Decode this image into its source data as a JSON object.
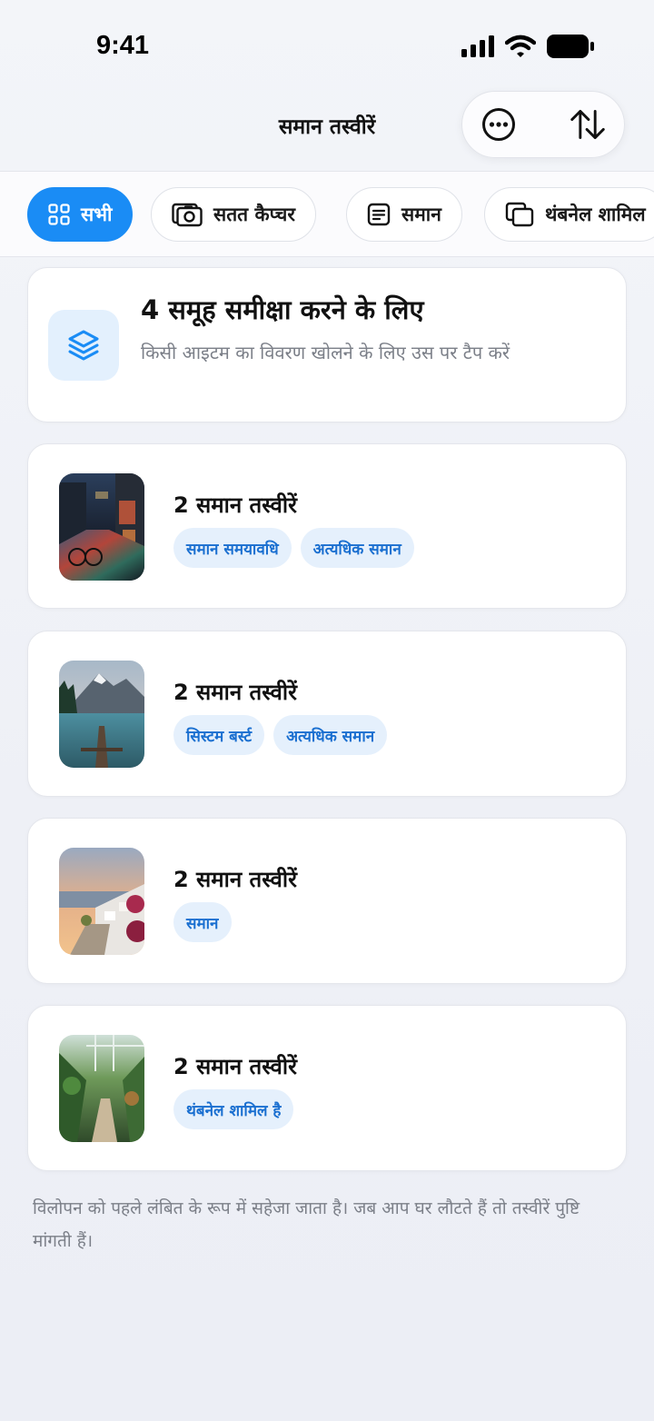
{
  "status_bar": {
    "time": "9:41"
  },
  "header": {
    "title": "समान तस्वीरें",
    "more_icon": "ellipsis-circle-icon",
    "sort_icon": "sort-arrows-icon"
  },
  "filters": [
    {
      "label": "सभी",
      "icon": "grid-icon",
      "active": true
    },
    {
      "label": "सतत कैप्चर",
      "icon": "camera-stack-icon",
      "active": false
    },
    {
      "label": "समान",
      "icon": "document-lines-icon",
      "active": false
    },
    {
      "label": "थंबनेल शामिल",
      "icon": "overlapping-squares-icon",
      "active": false
    }
  ],
  "summary": {
    "title": "4 समूह समीक्षा करने के लिए",
    "subtitle": "किसी आइटम का विवरण खोलने के लिए उस पर टैप करें",
    "icon": "layers-icon"
  },
  "groups": [
    {
      "title": "2 समान तस्वीरें",
      "thumbnail": "rainy-street-night-photo",
      "tags": [
        "समान समयावधि",
        "अत्यधिक समान"
      ]
    },
    {
      "title": "2 समान तस्वीरें",
      "thumbnail": "mountain-lake-pier-photo",
      "tags": [
        "सिस्टम बर्स्ट",
        "अत्यधिक समान"
      ]
    },
    {
      "title": "2 समान तस्वीरें",
      "thumbnail": "seaside-sunset-village-photo",
      "tags": [
        "समान"
      ]
    },
    {
      "title": "2 समान तस्वीरें",
      "thumbnail": "greenhouse-garden-path-photo",
      "tags": [
        "थंबनेल शामिल है"
      ]
    }
  ],
  "footer": {
    "note": "विलोपन को पहले लंबित के रूप में सहेजा जाता है। जब आप घर लौटते हैं तो तस्वीरें पुष्टि मांगती हैं।"
  },
  "colors": {
    "accent": "#1a8cf5",
    "tag_bg": "#e5f0fc",
    "tag_text": "#1a6fd0"
  }
}
